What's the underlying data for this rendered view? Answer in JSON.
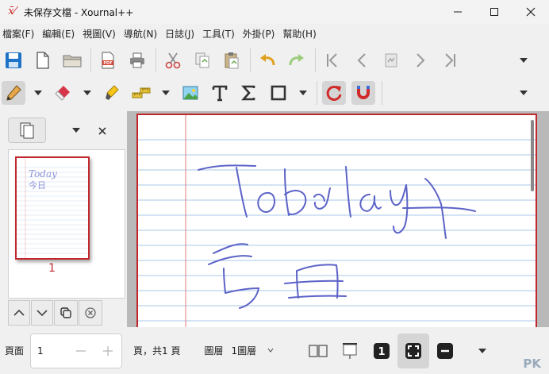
{
  "window": {
    "app_icon": "xournal-icon",
    "title": "未保存文檔 - Xournal++"
  },
  "menu": [
    {
      "label": "檔案(F)"
    },
    {
      "label": "編輯(E)"
    },
    {
      "label": "視圖(V)"
    },
    {
      "label": "導航(N)"
    },
    {
      "label": "日誌(J)"
    },
    {
      "label": "工具(T)"
    },
    {
      "label": "外掛(P)"
    },
    {
      "label": "幫助(H)"
    }
  ],
  "toolbar1_icons": [
    "save-icon",
    "new-document-icon",
    "open-folder-icon",
    "export-pdf-icon",
    "print-icon",
    "cut-icon",
    "copy-icon",
    "paste-icon",
    "undo-icon",
    "redo-icon",
    "first-page-icon",
    "previous-page-icon",
    "goto-page-icon",
    "next-page-icon",
    "last-page-icon"
  ],
  "toolbar2_icons": [
    "pen-icon",
    "eraser-icon",
    "highlighter-icon",
    "ruler-icon",
    "image-icon",
    "text-icon",
    "math-tex-icon",
    "shape-icon",
    "rotation-snap-icon",
    "grid-snap-icon"
  ],
  "sidebar": {
    "thumbnail_page_number": "1"
  },
  "page_content": {
    "handwriting_line1": "Today",
    "handwriting_line2": "今日"
  },
  "status": {
    "page_label": "頁面",
    "page_value": "1",
    "page_of": "頁，共1 頁",
    "layer_label": "圖層",
    "layer_value": "1圖層",
    "page_number_badge": "1"
  },
  "watermark": "PK",
  "colors": {
    "accent_red": "#c0282d",
    "ink_blue": "#5c63c7",
    "rule_blue": "#a9c9e8",
    "margin_red": "#e07a7a"
  }
}
